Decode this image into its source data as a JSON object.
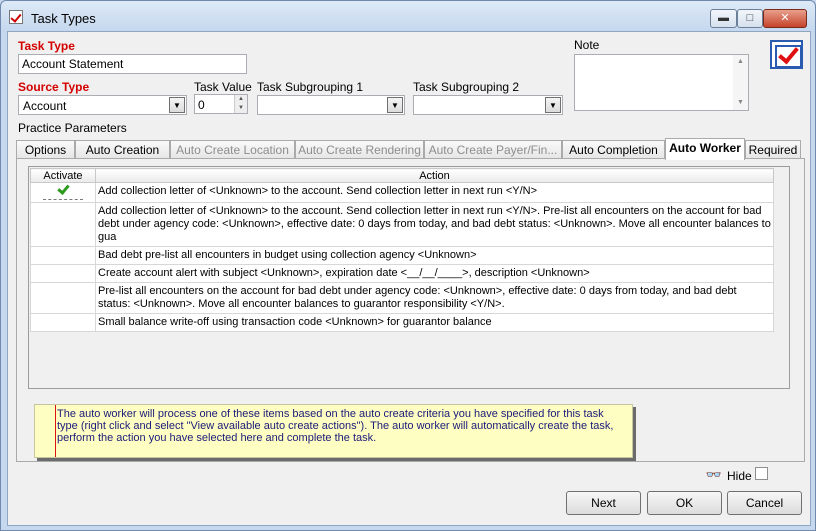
{
  "window": {
    "title": "Task Types",
    "min": "▬",
    "max": "□",
    "close": "✕"
  },
  "form": {
    "task_type_label": "Task Type",
    "task_type_value": "Account Statement",
    "source_type_label": "Source Type",
    "source_type_value": "Account",
    "task_value_label": "Task Value",
    "task_value": "0",
    "subgroup1_label": "Task Subgrouping 1",
    "subgroup1_value": "",
    "subgroup2_label": "Task Subgrouping 2",
    "subgroup2_value": "",
    "note_label": "Note",
    "note_value": "",
    "practice_params_label": "Practice Parameters"
  },
  "tabs": [
    {
      "label": "Options",
      "state": "normal"
    },
    {
      "label": "Auto Creation",
      "state": "normal"
    },
    {
      "label": "Auto Create Location",
      "state": "disabled"
    },
    {
      "label": "Auto Create Rendering",
      "state": "disabled"
    },
    {
      "label": "Auto Create  Payer/Fin...",
      "state": "disabled"
    },
    {
      "label": "Auto Completion",
      "state": "normal"
    },
    {
      "label": "Auto Worker",
      "state": "active"
    },
    {
      "label": "Required",
      "state": "normal"
    }
  ],
  "grid": {
    "headers": {
      "activate": "Activate",
      "action": "Action"
    },
    "rows": [
      {
        "active": true,
        "action": "Add collection letter of <Unknown> to the account.  Send collection letter in next run <Y/N>"
      },
      {
        "active": false,
        "action": "Add collection letter of <Unknown> to the account.  Send collection letter in next run <Y/N>.  Pre-list all encounters on the account for bad debt under agency code: <Unknown>, effective date: 0 days from today, and bad debt status: <Unknown>.  Move all encounter balances to gua"
      },
      {
        "active": false,
        "action": "Bad debt pre-list all encounters in budget using collection agency <Unknown>"
      },
      {
        "active": false,
        "action": "Create account alert with subject <Unknown>, expiration date <__/__/____>, description <Unknown>"
      },
      {
        "active": false,
        "action": "Pre-list all encounters on the account for bad debt under agency code: <Unknown>, effective date: 0 days from today, and bad debt status: <Unknown>. Move all encounter balances to guarantor responsibility <Y/N>."
      },
      {
        "active": false,
        "action": "Small balance write-off using transaction code <Unknown> for guarantor balance"
      }
    ]
  },
  "info_text": "The auto worker will process one of these items based on the auto create criteria you have specified for this task type (right click and select \"View available auto create actions\").  The auto worker will automatically create the task, perform the action you have selected here and complete the task.",
  "footer": {
    "hide_label": "Hide",
    "next_label": "Next",
    "ok_label": "OK",
    "cancel_label": "Cancel"
  }
}
